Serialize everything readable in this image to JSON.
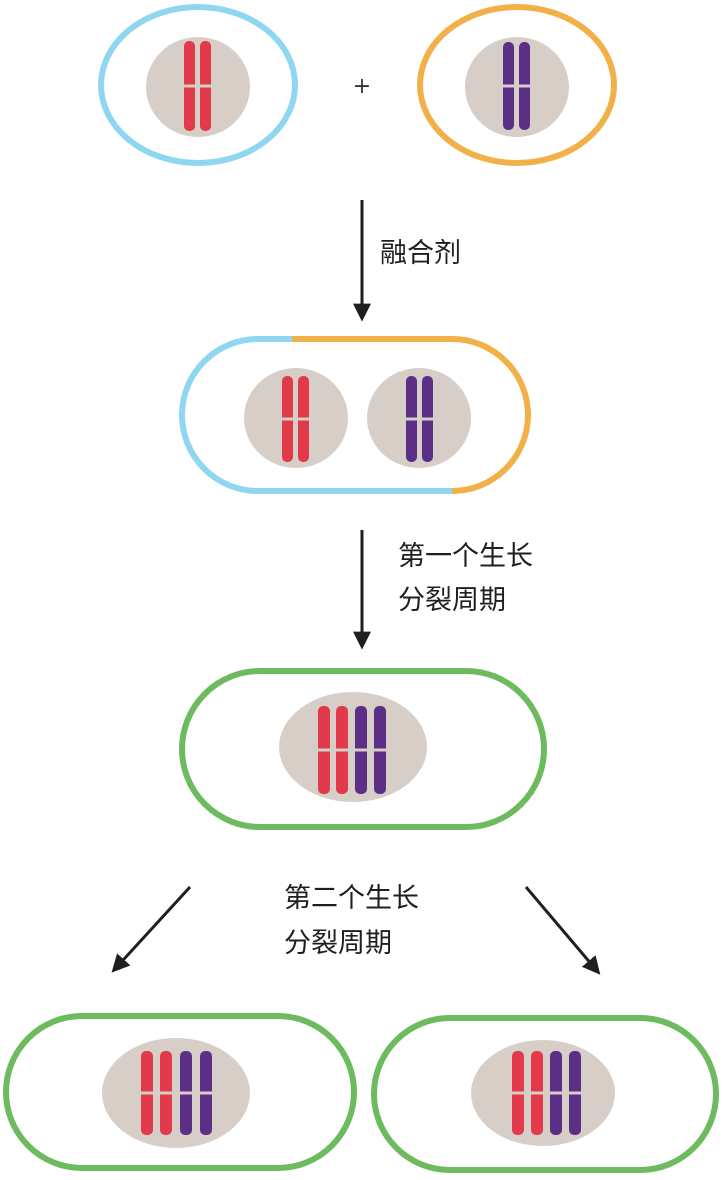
{
  "plus_sign": "+",
  "steps": [
    {
      "label_lines": [
        "融合剂"
      ]
    },
    {
      "label_lines": [
        "第一个生长",
        "分裂周期"
      ]
    },
    {
      "label_lines": [
        "第二个生长",
        "分裂周期"
      ]
    }
  ],
  "colors": {
    "cell_a_membrane": "#8fd6f0",
    "cell_b_membrane": "#f1b148",
    "daughter_membrane": "#6dbb5e",
    "nucleus": "#d8cec8",
    "chromosome_red": "#e23a4a",
    "chromosome_purple": "#5b2f86",
    "arrow": "#1f1f1f"
  },
  "chromosome_sets": {
    "cell_a": [
      "red",
      "red"
    ],
    "cell_b": [
      "purple",
      "purple"
    ],
    "hybrid": [
      "red",
      "red",
      "purple",
      "purple"
    ]
  }
}
